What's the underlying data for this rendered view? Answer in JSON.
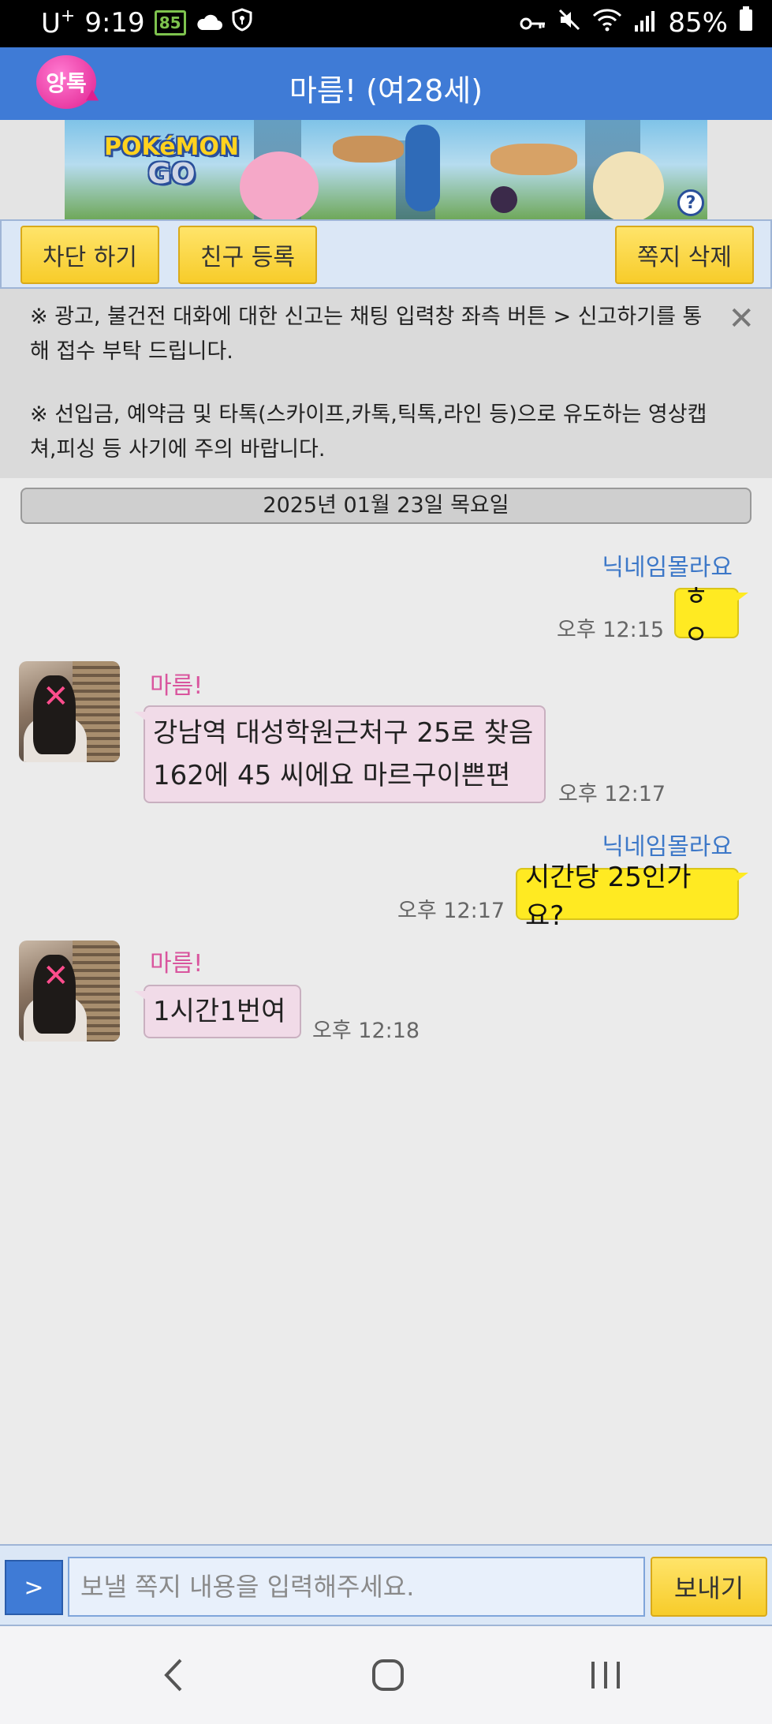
{
  "status_bar": {
    "carrier": "U",
    "carrier_sup": "+",
    "time": "9:19",
    "badge": "85",
    "battery": "85%"
  },
  "header": {
    "logo_text": "앙톡",
    "title": "마름! (여28세)"
  },
  "ad": {
    "logo_line1": "POKéMON",
    "logo_line2": "GO",
    "help": "?"
  },
  "toolbar": {
    "block_label": "차단 하기",
    "add_friend_label": "친구 등록",
    "delete_label": "쪽지 삭제"
  },
  "notice": {
    "line1": "※ 광고, 불건전 대화에 대한 신고는 채팅 입력창 좌측 버튼 > 신고하기를 통해 접수 부탁 드립니다.",
    "line2": "※ 선입금, 예약금 및 타톡(스카이프,카톡,틱톡,라인 등)으로 유도하는 영상캡쳐,피싱 등 사기에 주의 바랍니다.",
    "close": "✕"
  },
  "date_divider": "2025년 01월 23일 목요일",
  "messages": [
    {
      "side": "right",
      "nick": "닉네임몰라요",
      "text": "ㅎㅇ",
      "time": "오후 12:15"
    },
    {
      "side": "left",
      "nick": "마름!",
      "text_line1": "강남역 대성학원근처구 25로 찾음",
      "text_line2": "162에 45 씨에요 마르구이쁜편",
      "time": "오후 12:17"
    },
    {
      "side": "right",
      "nick": "닉네임몰라요",
      "text": "시간당 25인가요?",
      "time": "오후 12:17"
    },
    {
      "side": "left",
      "nick": "마름!",
      "text": "1시간1번여",
      "time": "오후 12:18"
    }
  ],
  "input": {
    "menu_button": ">",
    "placeholder": "보낼 쪽지 내용을 입력해주세요.",
    "send_label": "보내기"
  },
  "colors": {
    "header_blue": "#3f7bd6",
    "button_yellow": "#f7cc2a",
    "my_bubble": "#ffea22",
    "their_bubble": "#f1dbe8",
    "my_nick": "#3d78c8",
    "their_nick": "#d9559e"
  }
}
